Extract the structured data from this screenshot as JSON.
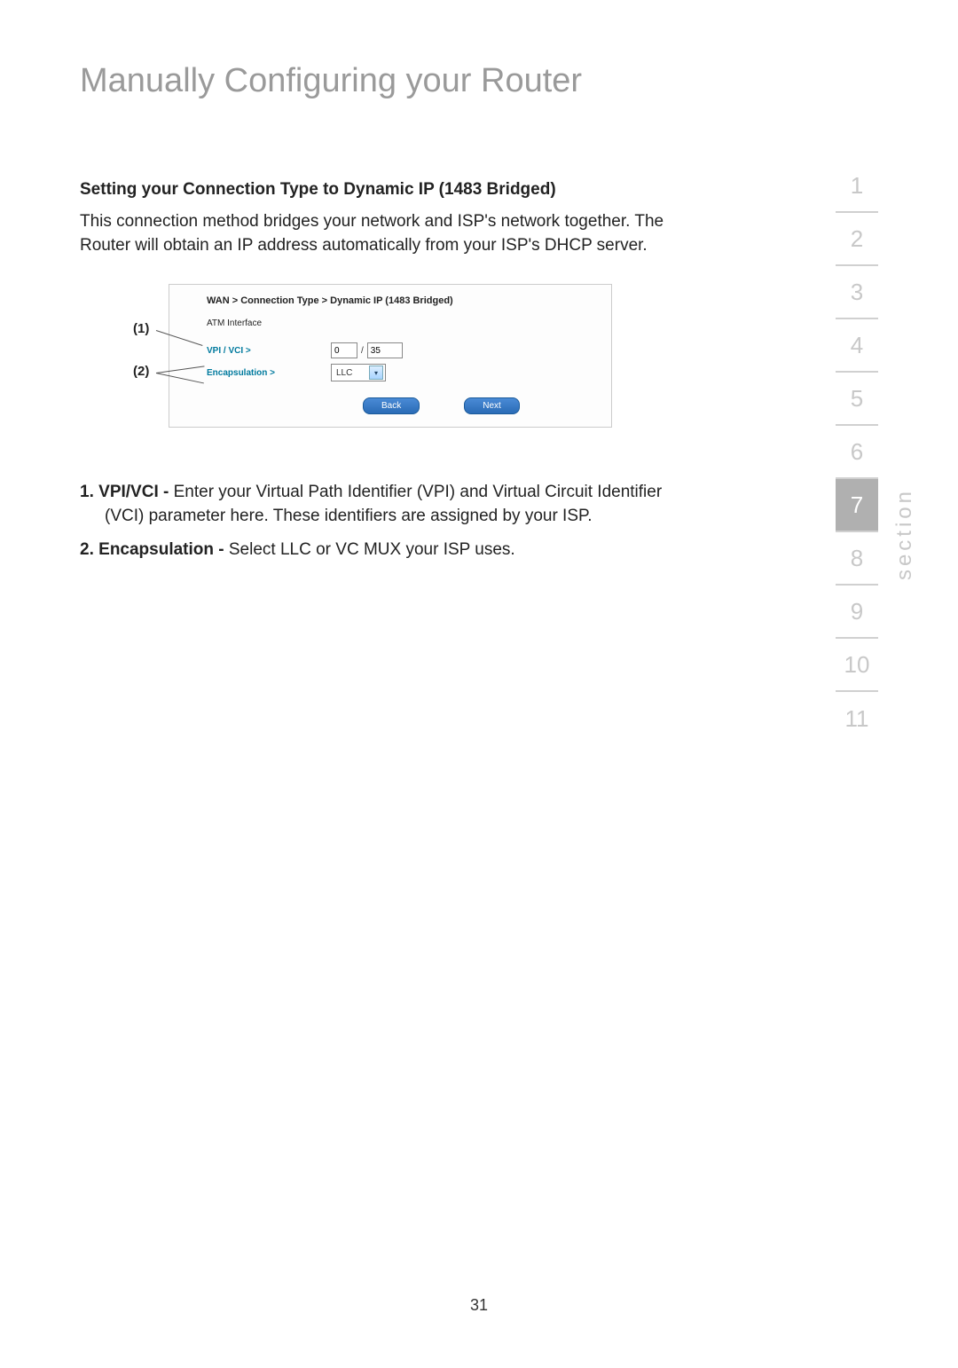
{
  "page": {
    "title": "Manually Configuring your Router",
    "number": "31"
  },
  "section": {
    "heading": "Setting your Connection Type to Dynamic IP (1483 Bridged)",
    "intro": "This connection method bridges your network and ISP's network together. The Router will obtain an IP address automatically from your ISP's DHCP server."
  },
  "callouts": {
    "one": "(1)",
    "two": "(2)"
  },
  "panel": {
    "breadcrumb": "WAN > Connection Type > Dynamic IP (1483 Bridged)",
    "atm_label": "ATM Interface",
    "vpi_vci_label": "VPI / VCI >",
    "vpi_value": "0",
    "slash": "/",
    "vci_value": "35",
    "encap_label": "Encapsulation >",
    "encap_value": "LLC",
    "back_btn": "Back",
    "next_btn": "Next"
  },
  "instructions": {
    "item1_num": "1.",
    "item1_term": "VPI/VCI -",
    "item1_text": " Enter your Virtual Path Identifier (VPI) and Virtual Circuit Identifier (VCI) parameter here. These identifiers are assigned by your ISP.",
    "item2_num": "2.",
    "item2_term": "Encapsulation -",
    "item2_text": " Select LLC or VC MUX your ISP uses."
  },
  "nav": {
    "label": "section",
    "items": [
      "1",
      "2",
      "3",
      "4",
      "5",
      "6",
      "7",
      "8",
      "9",
      "10",
      "11"
    ],
    "active_index": 6
  }
}
